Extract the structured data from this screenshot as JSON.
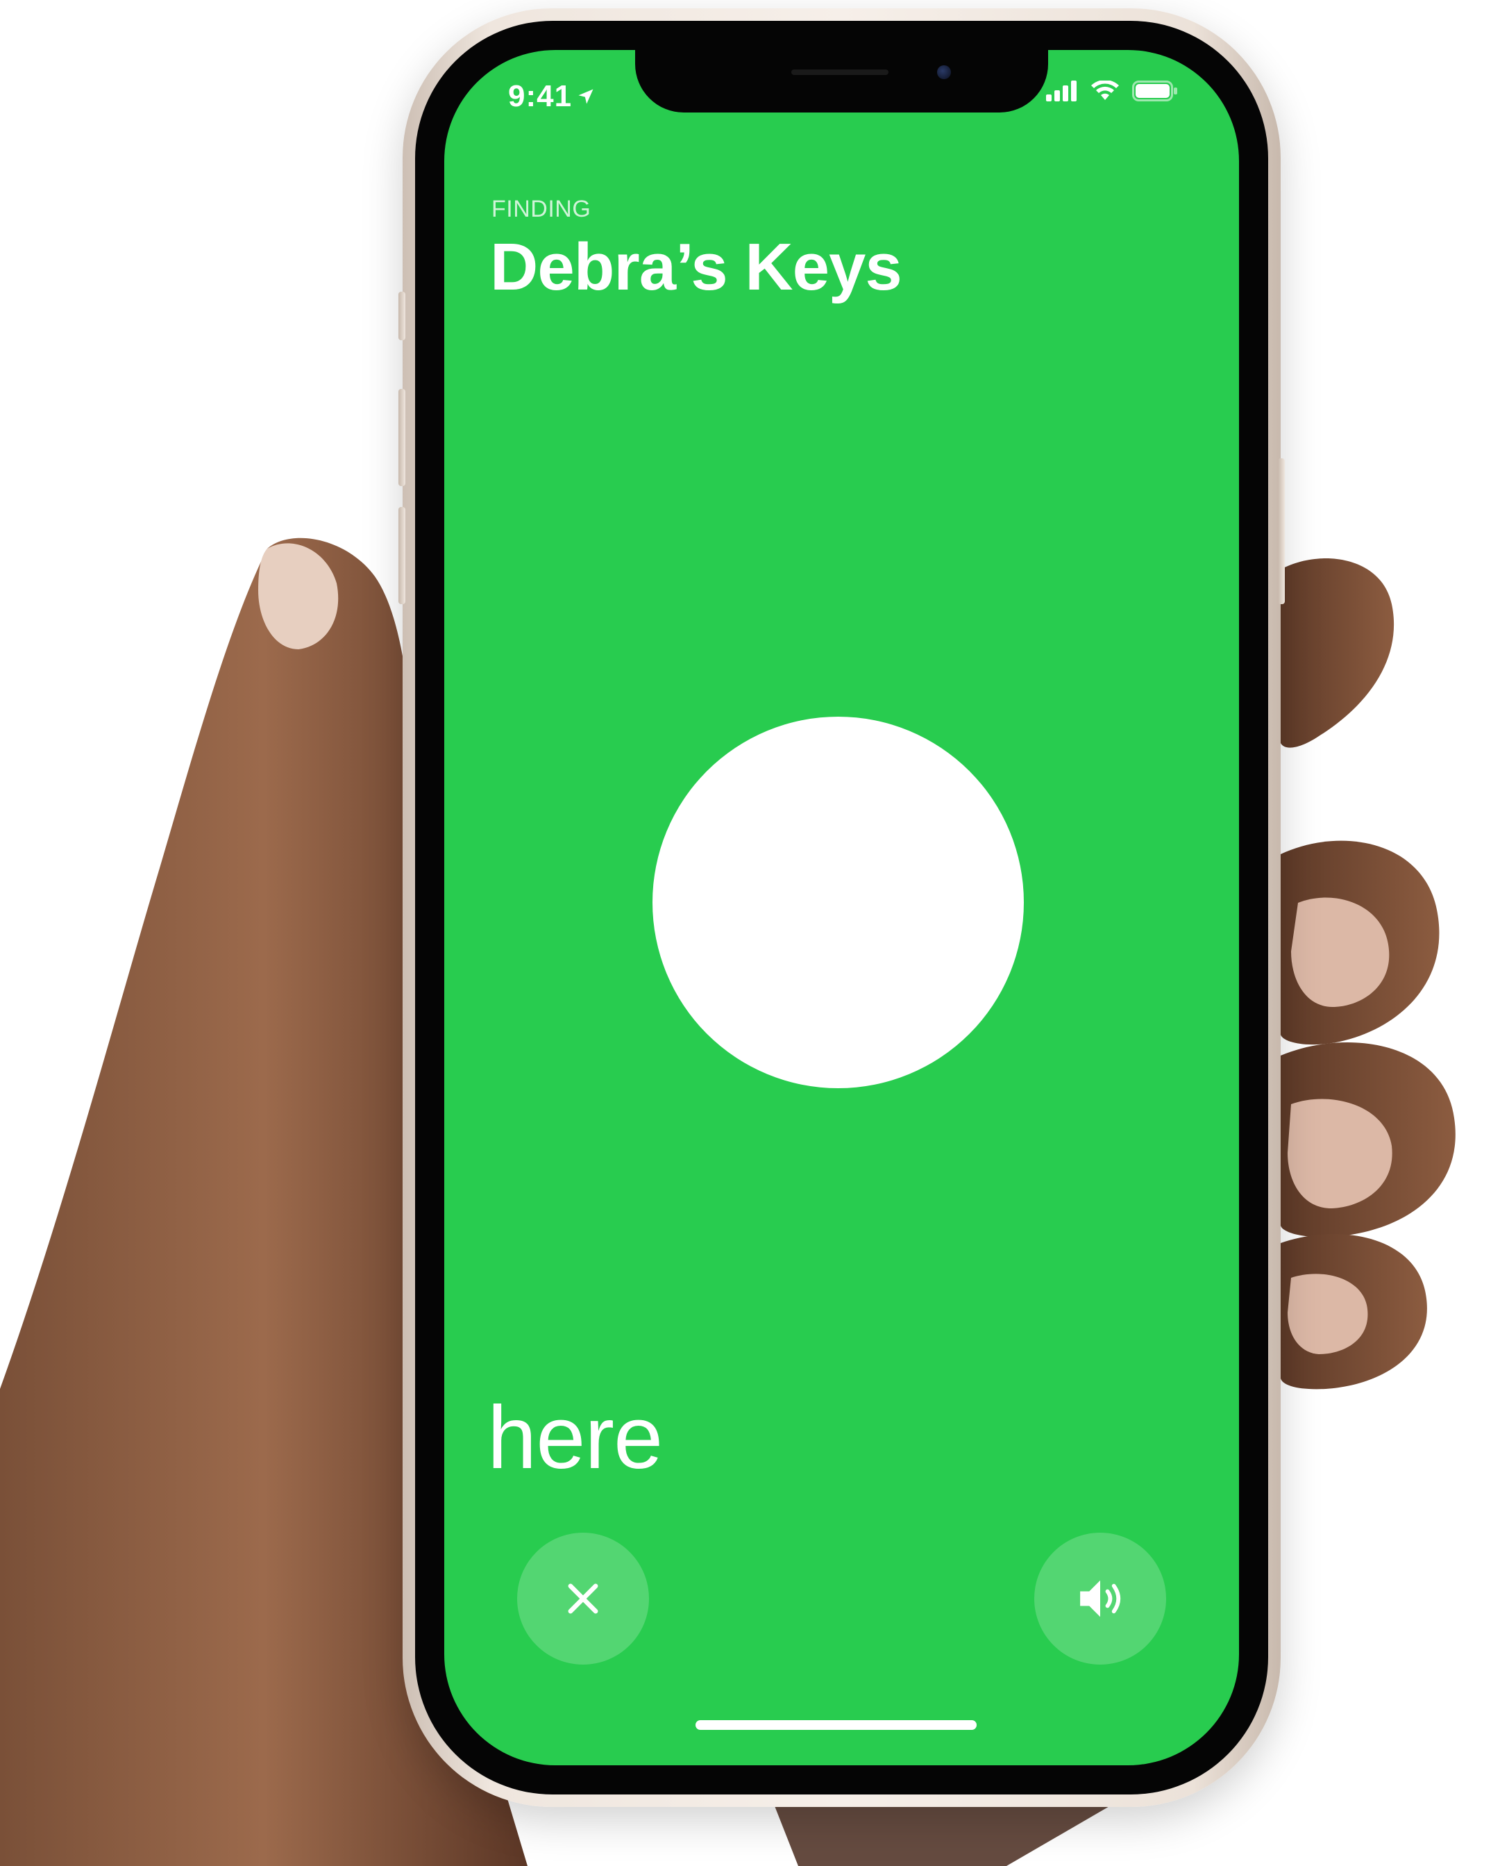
{
  "colors": {
    "accent": "#28cc4f",
    "foreground": "#ffffff"
  },
  "status_bar": {
    "time": "9:41",
    "icons": [
      "location-arrow-icon",
      "signal-icon",
      "wifi-icon",
      "battery-icon"
    ]
  },
  "header": {
    "eyebrow": "FINDING",
    "title": "Debra’s Keys"
  },
  "finder": {
    "proximity_label": "here"
  },
  "controls": {
    "close_icon": "close-icon",
    "sound_icon": "speaker-icon"
  }
}
